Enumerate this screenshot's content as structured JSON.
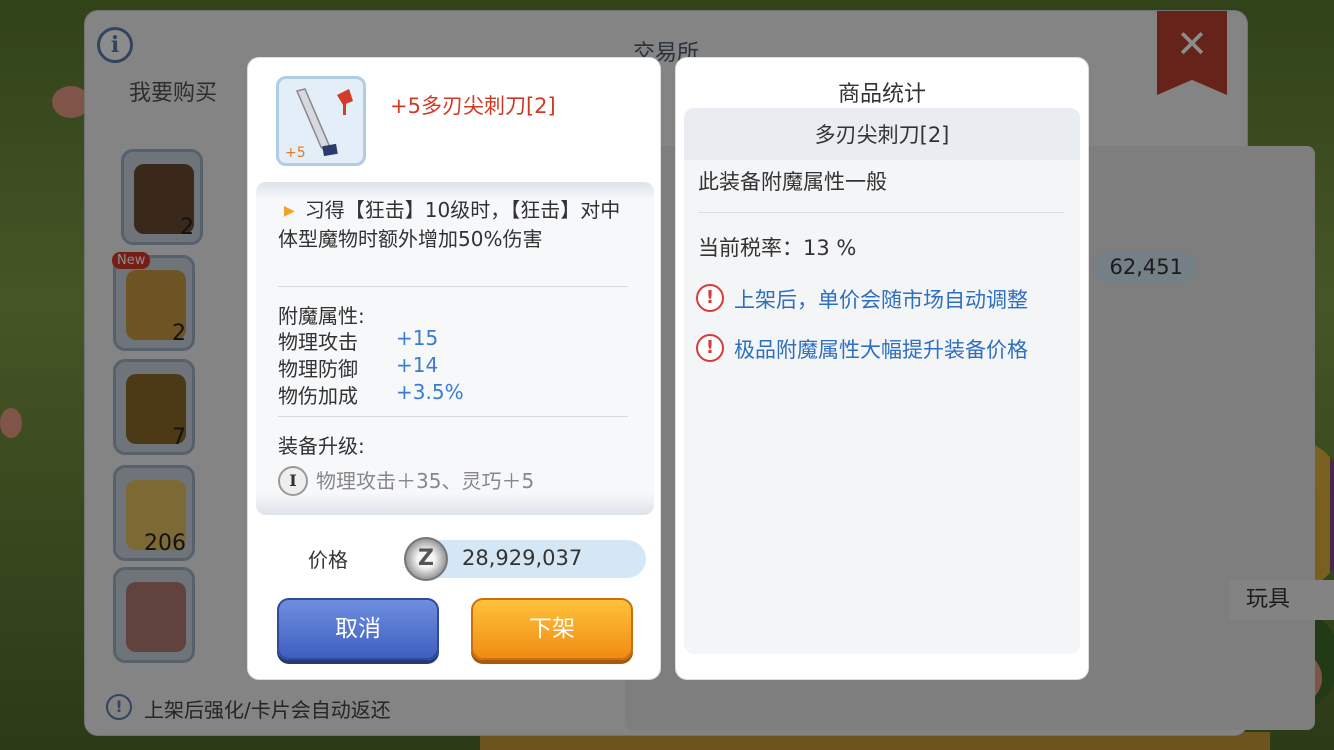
{
  "exchange": {
    "title": "交易所",
    "buy_tab": "我要购买",
    "new_tag": "New",
    "bag_counts": [
      "2",
      "2",
      "7",
      "206"
    ],
    "side_price": "62,451",
    "toy_label": "玩具",
    "bottom_note": "上架后强化/卡片会自动返还"
  },
  "item": {
    "level_badge": "+5",
    "name": "+5多刃尖刺刀[2]",
    "skill_text": "习得【狂击】10级时，【狂击】对中体型魔物时额外增加50%伤害",
    "enchant_title": "附魔属性:",
    "enchants": [
      {
        "label": "物理攻击",
        "value": "+15"
      },
      {
        "label": "物理防御",
        "value": "+14"
      },
      {
        "label": "物伤加成",
        "value": "+3.5%"
      }
    ],
    "upgrade_title": "装备升级:",
    "upgrade_tier": "I",
    "upgrade_text": "物理攻击＋35、灵巧＋5",
    "price_label": "价格",
    "price_value": "28,929,037",
    "zeny_symbol": "Z",
    "cancel_label": "取消",
    "delist_label": "下架"
  },
  "stats": {
    "title": "商品统计",
    "item_name": "多刃尖刺刀[2]",
    "enchant_quality": "此装备附魔属性一般",
    "tax_rate": "当前税率：13 %",
    "warnings": [
      "上架后，单价会随市场自动调整",
      "极品附魔属性大幅提升装备价格"
    ]
  },
  "colors": {
    "item_name": "#d03a24",
    "enchant_value": "#3a7bd5",
    "warning_text": "#2f6fbf",
    "cancel_button": "#3f5fbf",
    "delist_button": "#f08c12"
  }
}
